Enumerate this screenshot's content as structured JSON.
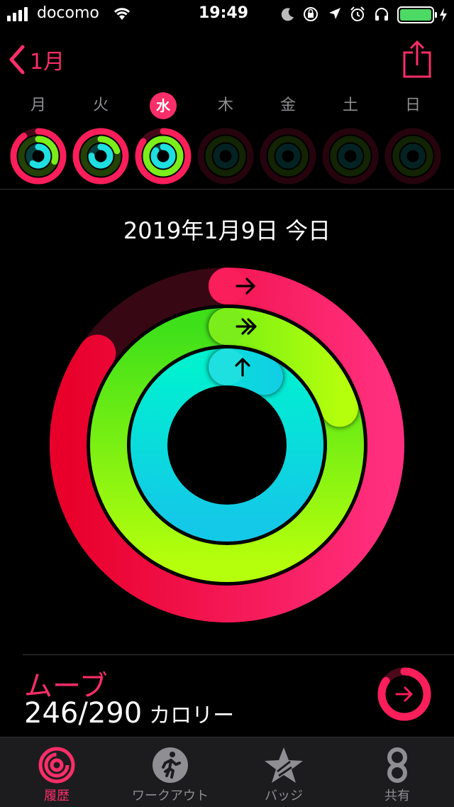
{
  "status_bar": {
    "carrier": "docomo",
    "time": "19:49"
  },
  "nav": {
    "back_label": "1月"
  },
  "week": [
    {
      "label": "月",
      "today": false,
      "move": 0.9,
      "exercise": 0.3,
      "stand": 0.6,
      "future": false
    },
    {
      "label": "火",
      "today": false,
      "move": 1.0,
      "exercise": 0.2,
      "stand": 0.75,
      "future": false
    },
    {
      "label": "水",
      "today": true,
      "move": 0.85,
      "exercise": 1.0,
      "stand": 0.85,
      "future": false
    },
    {
      "label": "木",
      "today": false,
      "move": 0,
      "exercise": 0,
      "stand": 0,
      "future": true
    },
    {
      "label": "金",
      "today": false,
      "move": 0,
      "exercise": 0,
      "stand": 0,
      "future": true
    },
    {
      "label": "土",
      "today": false,
      "move": 0,
      "exercise": 0,
      "stand": 0,
      "future": true
    },
    {
      "label": "日",
      "today": false,
      "move": 0,
      "exercise": 0,
      "stand": 0,
      "future": true
    }
  ],
  "date": "2019年1月9日 今日",
  "rings": {
    "move": 0.848,
    "exercise": 1.2,
    "stand": 1.08
  },
  "move_summary": {
    "title": "ムーブ",
    "value": "246/290",
    "unit": "カロリー"
  },
  "tabs": [
    {
      "label": "履歴",
      "active": true
    },
    {
      "label": "ワークアウト",
      "active": false
    },
    {
      "label": "バッジ",
      "active": false
    },
    {
      "label": "共有",
      "active": false
    }
  ],
  "colors": {
    "move": "#fa1e5a",
    "exercise": "#7bed1a",
    "stand": "#1ee0e0",
    "accent": "#fa2e68"
  }
}
